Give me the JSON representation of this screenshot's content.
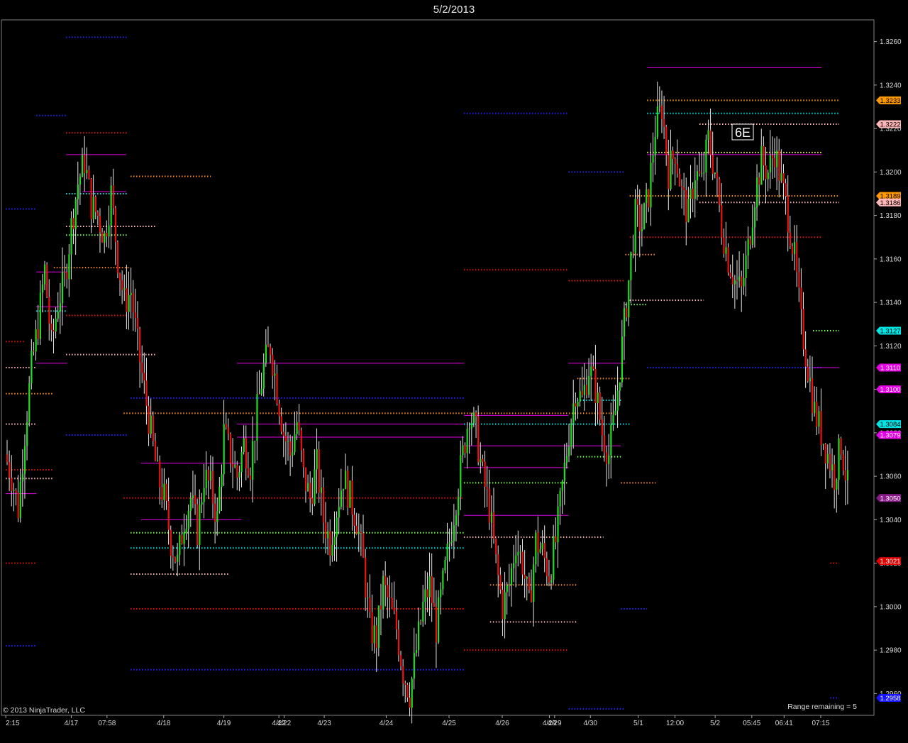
{
  "window": {
    "title": "5/2/2013"
  },
  "chart_data": {
    "type": "candlestick",
    "instrument": "6E",
    "copyright": "© 2013 NinjaTrader, LLC",
    "status": "Range remaining = 5",
    "ylim": [
      1.295,
      1.327
    ],
    "y_ticks": [
      "1.3260",
      "1.3240",
      "1.3220",
      "1.3200",
      "1.3180",
      "1.3160",
      "1.3140",
      "1.3120",
      "1.3100",
      "1.3080",
      "1.3060",
      "1.3040",
      "1.3020",
      "1.3000",
      "1.2980",
      "1.2960"
    ],
    "x_labels": [
      "2:15",
      "4/17",
      "07:58",
      "4/18",
      "4/19",
      "4/22",
      "4/22",
      "4/23",
      "4/24",
      "4/25",
      "4/26",
      "4/29",
      "4/29",
      "4/30",
      "5/1",
      "12:00",
      "5/2",
      "05:45",
      "06:41",
      "07:15"
    ],
    "price_tags": [
      {
        "label": "1.3233",
        "value": 1.3233,
        "color": "#ff9900",
        "text_color": "#000000"
      },
      {
        "label": "1.3222",
        "value": 1.3222,
        "color": "#ffb6b6",
        "text_color": "#000000"
      },
      {
        "label": "1.3189",
        "value": 1.3189,
        "color": "#ff9900",
        "text_color": "#000000"
      },
      {
        "label": "1.3186",
        "value": 1.3186,
        "color": "#ffb6b6",
        "text_color": "#000000"
      },
      {
        "label": "1.3127",
        "value": 1.3127,
        "color": "#00e5e5",
        "text_color": "#000000"
      },
      {
        "label": "1.3110",
        "value": 1.311,
        "color": "#e600e6",
        "text_color": "#ffffff"
      },
      {
        "label": "1.3100",
        "value": 1.31,
        "color": "#e600e6",
        "text_color": "#ffffff"
      },
      {
        "label": "1.3084",
        "value": 1.3084,
        "color": "#00e5e5",
        "text_color": "#000000"
      },
      {
        "label": "1.3079",
        "value": 1.3079,
        "color": "#e600e6",
        "text_color": "#ffffff"
      },
      {
        "label": "1.3050",
        "value": 1.305,
        "color": "#8a1a8a",
        "text_color": "#ffffff"
      },
      {
        "label": "1.3021",
        "value": 1.3021,
        "color": "#e00000",
        "text_color": "#ffffff"
      },
      {
        "label": "1.2958",
        "value": 1.2958,
        "color": "#1515ff",
        "text_color": "#ffffff"
      }
    ],
    "close_path": [
      1.307,
      1.306,
      1.3045,
      1.308,
      1.311,
      1.313,
      1.3155,
      1.312,
      1.314,
      1.315,
      1.3175,
      1.3195,
      1.3205,
      1.3185,
      1.318,
      1.317,
      1.319,
      1.316,
      1.314,
      1.3145,
      1.312,
      1.31,
      1.308,
      1.306,
      1.305,
      1.303,
      1.302,
      1.304,
      1.305,
      1.3035,
      1.306,
      1.3055,
      1.304,
      1.308,
      1.307,
      1.306,
      1.3075,
      1.3065,
      1.309,
      1.311,
      1.312,
      1.31,
      1.308,
      1.307,
      1.3085,
      1.306,
      1.305,
      1.3065,
      1.304,
      1.303,
      1.3045,
      1.306,
      1.305,
      1.304,
      1.302,
      1.299,
      1.2985,
      1.301,
      1.3,
      1.299,
      1.297,
      1.296,
      1.298,
      1.3,
      1.301,
      1.299,
      1.301,
      1.303,
      1.305,
      1.307,
      1.309,
      1.308,
      1.306,
      1.3045,
      1.302,
      1.3,
      1.301,
      1.303,
      1.302,
      1.3,
      1.303,
      1.3025,
      1.3015,
      1.303,
      1.3055,
      1.308,
      1.31,
      1.3095,
      1.311,
      1.31,
      1.308,
      1.307,
      1.309,
      1.312,
      1.315,
      1.318,
      1.3175,
      1.319,
      1.322,
      1.323,
      1.32,
      1.321,
      1.319,
      1.318,
      1.32,
      1.3195,
      1.3215,
      1.32,
      1.3175,
      1.316,
      1.315,
      1.3145,
      1.3165,
      1.319,
      1.3205,
      1.32,
      1.321,
      1.3195,
      1.318,
      1.316,
      1.313,
      1.311,
      1.309,
      1.308,
      1.307,
      1.306,
      1.3075,
      1.3055
    ],
    "levels": [
      {
        "value": 1.3262,
        "x0": 0.074,
        "x1": 0.145,
        "color": "#2222ff"
      },
      {
        "value": 1.3226,
        "x0": 0.04,
        "x1": 0.075,
        "color": "#2222ff"
      },
      {
        "value": 1.3218,
        "x0": 0.074,
        "x1": 0.145,
        "color": "#e01010"
      },
      {
        "value": 1.3198,
        "x0": 0.148,
        "x1": 0.24,
        "color": "#ff8c2a"
      },
      {
        "value": 1.319,
        "x0": 0.074,
        "x1": 0.145,
        "color": "#00e5e5"
      },
      {
        "value": 1.3183,
        "x0": 0.005,
        "x1": 0.04,
        "color": "#2222ff"
      },
      {
        "value": 1.3175,
        "x0": 0.074,
        "x1": 0.177,
        "color": "#ffb6b6"
      },
      {
        "value": 1.3171,
        "x0": 0.074,
        "x1": 0.145,
        "color": "#7dff5a"
      },
      {
        "value": 1.3156,
        "x0": 0.06,
        "x1": 0.148,
        "color": "#ff8c2a"
      },
      {
        "value": 1.3136,
        "x0": 0.04,
        "x1": 0.075,
        "color": "#00e5e5"
      },
      {
        "value": 1.3134,
        "x0": 0.074,
        "x1": 0.145,
        "color": "#e01010"
      },
      {
        "value": 1.3122,
        "x0": 0.005,
        "x1": 0.027,
        "color": "#e01010"
      },
      {
        "value": 1.3116,
        "x0": 0.074,
        "x1": 0.177,
        "color": "#ffb6b6"
      },
      {
        "value": 1.311,
        "x0": 0.005,
        "x1": 0.04,
        "color": "#ffb6b6"
      },
      {
        "value": 1.3098,
        "x0": 0.005,
        "x1": 0.06,
        "color": "#ff8c2a"
      },
      {
        "value": 1.3096,
        "x0": 0.148,
        "x1": 0.53,
        "color": "#2222ff"
      },
      {
        "value": 1.3089,
        "x0": 0.14,
        "x1": 0.53,
        "color": "#ff8c2a"
      },
      {
        "value": 1.3084,
        "x0": 0.005,
        "x1": 0.04,
        "color": "#ffb6b6"
      },
      {
        "value": 1.3079,
        "x0": 0.074,
        "x1": 0.145,
        "color": "#2222ff"
      },
      {
        "value": 1.3063,
        "x0": 0.005,
        "x1": 0.06,
        "color": "#e01010"
      },
      {
        "value": 1.3059,
        "x0": 0.005,
        "x1": 0.06,
        "color": "#ffb6b6"
      },
      {
        "value": 1.305,
        "x0": 0.14,
        "x1": 0.53,
        "color": "#e01010"
      },
      {
        "value": 1.3034,
        "x0": 0.148,
        "x1": 0.53,
        "color": "#7dff5a"
      },
      {
        "value": 1.3027,
        "x0": 0.148,
        "x1": 0.53,
        "color": "#00e5e5"
      },
      {
        "value": 1.302,
        "x0": 0.005,
        "x1": 0.04,
        "color": "#e01010"
      },
      {
        "value": 1.3015,
        "x0": 0.148,
        "x1": 0.26,
        "color": "#ffb6b6"
      },
      {
        "value": 1.2999,
        "x0": 0.148,
        "x1": 0.53,
        "color": "#e01010"
      },
      {
        "value": 1.2982,
        "x0": 0.005,
        "x1": 0.04,
        "color": "#2222ff"
      },
      {
        "value": 1.2971,
        "x0": 0.148,
        "x1": 0.53,
        "color": "#2222ff"
      },
      {
        "value": 1.3227,
        "x0": 0.53,
        "x1": 0.65,
        "color": "#2222ff"
      },
      {
        "value": 1.3155,
        "x0": 0.53,
        "x1": 0.65,
        "color": "#e01010"
      },
      {
        "value": 1.3089,
        "x0": 0.53,
        "x1": 0.7,
        "color": "#ff8c2a"
      },
      {
        "value": 1.3084,
        "x0": 0.53,
        "x1": 0.72,
        "color": "#00e5e5"
      },
      {
        "value": 1.3057,
        "x0": 0.53,
        "x1": 0.65,
        "color": "#7dff5a"
      },
      {
        "value": 1.3032,
        "x0": 0.53,
        "x1": 0.69,
        "color": "#ffb6b6"
      },
      {
        "value": 1.301,
        "x0": 0.56,
        "x1": 0.66,
        "color": "#ff8c2a"
      },
      {
        "value": 1.2993,
        "x0": 0.56,
        "x1": 0.66,
        "color": "#ffb6b6"
      },
      {
        "value": 1.298,
        "x0": 0.53,
        "x1": 0.65,
        "color": "#e01010"
      },
      {
        "value": 1.32,
        "x0": 0.65,
        "x1": 0.715,
        "color": "#2222ff"
      },
      {
        "value": 1.315,
        "x0": 0.65,
        "x1": 0.715,
        "color": "#e01010"
      },
      {
        "value": 1.3233,
        "x0": 0.74,
        "x1": 0.96,
        "color": "#ff9900"
      },
      {
        "value": 1.3227,
        "x0": 0.74,
        "x1": 0.96,
        "color": "#00e5e5"
      },
      {
        "value": 1.3222,
        "x0": 0.8,
        "x1": 0.96,
        "color": "#ffb6b6"
      },
      {
        "value": 1.3209,
        "x0": 0.74,
        "x1": 0.94,
        "color": "#ffff66"
      },
      {
        "value": 1.3189,
        "x0": 0.72,
        "x1": 0.96,
        "color": "#ff9900"
      },
      {
        "value": 1.3186,
        "x0": 0.8,
        "x1": 0.96,
        "color": "#ffb6b6"
      },
      {
        "value": 1.317,
        "x0": 0.72,
        "x1": 0.94,
        "color": "#e01010"
      },
      {
        "value": 1.3162,
        "x0": 0.715,
        "x1": 0.75,
        "color": "#ff8c2a"
      },
      {
        "value": 1.3141,
        "x0": 0.72,
        "x1": 0.805,
        "color": "#ffb6b6"
      },
      {
        "value": 1.3139,
        "x0": 0.715,
        "x1": 0.74,
        "color": "#7dff5a"
      },
      {
        "value": 1.3127,
        "x0": 0.93,
        "x1": 0.96,
        "color": "#7dff5a"
      },
      {
        "value": 1.311,
        "x0": 0.74,
        "x1": 0.94,
        "color": "#2222ff"
      },
      {
        "value": 1.3105,
        "x0": 0.66,
        "x1": 0.72,
        "color": "#ff8c2a"
      },
      {
        "value": 1.3095,
        "x0": 0.66,
        "x1": 0.71,
        "color": "#00e5e5"
      },
      {
        "value": 1.3069,
        "x0": 0.66,
        "x1": 0.71,
        "color": "#7dff5a"
      },
      {
        "value": 1.3057,
        "x0": 0.71,
        "x1": 0.75,
        "color": "#ff8c2a"
      },
      {
        "value": 1.302,
        "x0": 0.95,
        "x1": 0.96,
        "color": "#e01010"
      },
      {
        "value": 1.2999,
        "x0": 0.71,
        "x1": 0.74,
        "color": "#2222ff"
      },
      {
        "value": 1.2958,
        "x0": 0.95,
        "x1": 0.96,
        "color": "#2222ff"
      },
      {
        "value": 1.2953,
        "x0": 0.65,
        "x1": 0.715,
        "color": "#2222ff"
      }
    ],
    "magenta_lines": [
      {
        "value": 1.3248,
        "x0": 0.74,
        "x1": 0.94
      },
      {
        "value": 1.3208,
        "x0": 0.074,
        "x1": 0.143
      },
      {
        "value": 1.3191,
        "x0": 0.093,
        "x1": 0.143
      },
      {
        "value": 1.3154,
        "x0": 0.04,
        "x1": 0.075
      },
      {
        "value": 1.3138,
        "x0": 0.04,
        "x1": 0.075
      },
      {
        "value": 1.3112,
        "x0": 0.04,
        "x1": 0.075
      },
      {
        "value": 1.3112,
        "x0": 0.27,
        "x1": 0.53
      },
      {
        "value": 1.3084,
        "x0": 0.27,
        "x1": 0.53
      },
      {
        "value": 1.3078,
        "x0": 0.27,
        "x1": 0.53
      },
      {
        "value": 1.3066,
        "x0": 0.16,
        "x1": 0.275
      },
      {
        "value": 1.3052,
        "x0": 0.005,
        "x1": 0.04
      },
      {
        "value": 1.304,
        "x0": 0.16,
        "x1": 0.275
      },
      {
        "value": 1.3088,
        "x0": 0.53,
        "x1": 0.65
      },
      {
        "value": 1.3074,
        "x0": 0.53,
        "x1": 0.71
      },
      {
        "value": 1.3064,
        "x0": 0.53,
        "x1": 0.65
      },
      {
        "value": 1.3042,
        "x0": 0.53,
        "x1": 0.65
      },
      {
        "value": 1.3112,
        "x0": 0.65,
        "x1": 0.715
      },
      {
        "value": 1.3208,
        "x0": 0.74,
        "x1": 0.94
      },
      {
        "value": 1.311,
        "x0": 0.93,
        "x1": 0.96
      }
    ]
  }
}
